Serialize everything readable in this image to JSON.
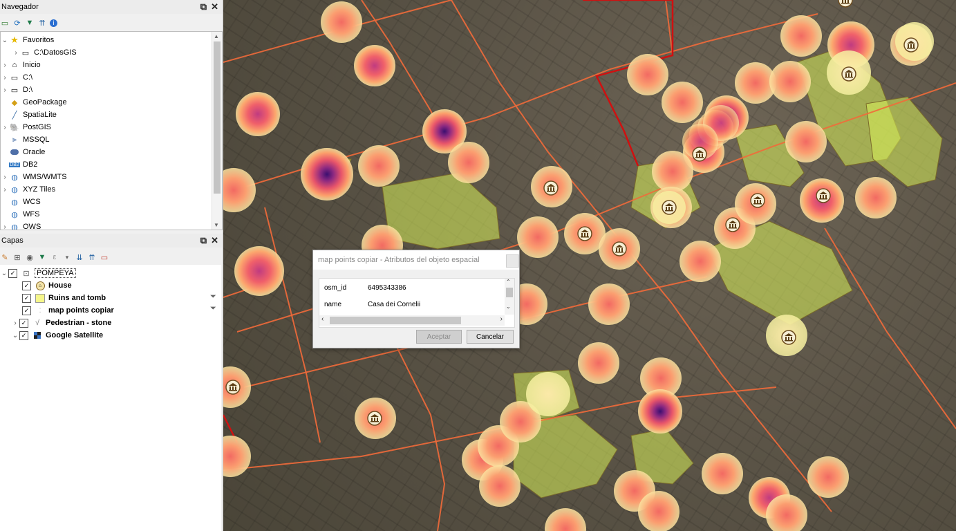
{
  "browser": {
    "title": "Navegador",
    "items": [
      {
        "label": "Favoritos",
        "icon": "star-icon"
      },
      {
        "label": "C:\\DatosGIS",
        "icon": "folder-icon"
      },
      {
        "label": "Inicio",
        "icon": "home-icon"
      },
      {
        "label": "C:\\",
        "icon": "folder-icon"
      },
      {
        "label": "D:\\",
        "icon": "folder-icon"
      },
      {
        "label": "GeoPackage",
        "icon": "geopackage-icon"
      },
      {
        "label": "SpatiaLite",
        "icon": "spatialite-icon"
      },
      {
        "label": "PostGIS",
        "icon": "postgis-icon"
      },
      {
        "label": "MSSQL",
        "icon": "mssql-icon"
      },
      {
        "label": "Oracle",
        "icon": "oracle-icon"
      },
      {
        "label": "DB2",
        "icon": "db2-icon"
      },
      {
        "label": "WMS/WMTS",
        "icon": "globe-icon"
      },
      {
        "label": "XYZ Tiles",
        "icon": "globe-icon"
      },
      {
        "label": "WCS",
        "icon": "globe-icon"
      },
      {
        "label": "WFS",
        "icon": "globe-icon"
      },
      {
        "label": "OWS",
        "icon": "globe-icon"
      }
    ],
    "db2_badge": "DB2"
  },
  "layers": {
    "title": "Capas",
    "group": "POMPEYA",
    "items": [
      {
        "label": "House",
        "icon": "temple-icon"
      },
      {
        "label": "Ruins and tomb",
        "icon": "yellow-fill-icon"
      },
      {
        "label": "map points copiar",
        "icon": "heatmap-points-icon"
      },
      {
        "label": "Pedestrian - stone",
        "icon": "line-icon"
      },
      {
        "label": "Google Satellite",
        "icon": "raster-icon"
      }
    ]
  },
  "dialog": {
    "title": "map points copiar - Atributos del objeto espacial",
    "fields": [
      {
        "key": "osm_id",
        "value": "6495343386"
      },
      {
        "key": "name",
        "value": "Casa dei Cornelii"
      }
    ],
    "ok_label": "Aceptar",
    "cancel_label": "Cancelar"
  },
  "colors": {
    "heat_hot": "#3b0f70",
    "heat_mid": "#e8556a",
    "heat_cool": "#fbe3a0",
    "ruins": "#d8f05a",
    "roads": "#f26a3a"
  }
}
